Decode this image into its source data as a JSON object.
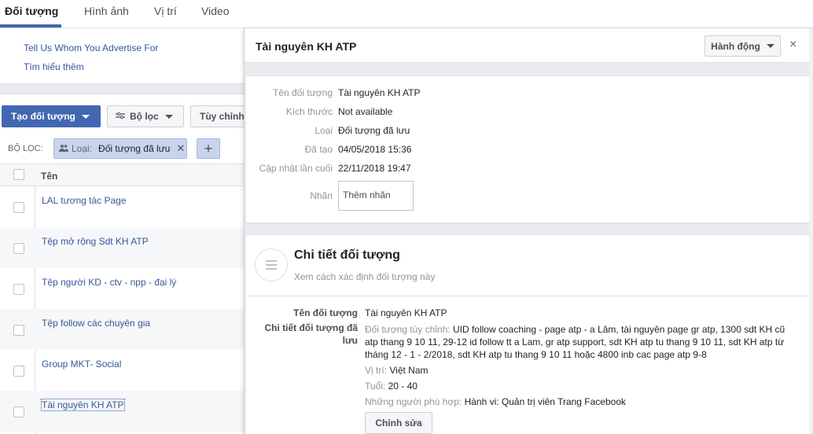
{
  "tabs": [
    {
      "label": "Đối tượng",
      "active": true
    },
    {
      "label": "Hình ảnh",
      "active": false
    },
    {
      "label": "Vị trí",
      "active": false
    },
    {
      "label": "Video",
      "active": false
    }
  ],
  "left": {
    "links": [
      "Tell Us Whom You Advertise For",
      "Tìm hiểu thêm"
    ],
    "create_button": "Tạo đối tượng",
    "filter_button": "Bộ lọc",
    "custom_button": "Tùy chỉnh",
    "filter_label": "BỘ LỌC:",
    "chip": {
      "key": "Loại:",
      "value": "Đối tượng đã lưu"
    },
    "table_header": "Tên",
    "rows": [
      "LAL tương tác Page",
      "Tệp mở rộng Sdt KH ATP",
      "Tệp người KD - ctv - npp - đại lý",
      "Tệp follow các chuyên gia",
      "Group MKT- Social",
      "Tài nguyên KH ATP"
    ]
  },
  "panel": {
    "title": "Tài nguyên KH ATP",
    "action_button": "Hành động",
    "close": "×",
    "details": [
      {
        "label": "Tên đối tượng",
        "value": "Tài nguyên KH ATP"
      },
      {
        "label": "Kích thước",
        "value": "Not available"
      },
      {
        "label": "Loại",
        "value": "Đối tượng đã lưu"
      },
      {
        "label": "Đã tạo",
        "value": "04/05/2018 15:36"
      },
      {
        "label": "Cập nhật lần cuối",
        "value": "22/11/2018 19:47"
      }
    ],
    "tag_label": "Nhãn",
    "tag_placeholder": "Thêm nhãn",
    "section": {
      "title": "Chi tiết đối tượng",
      "subtitle": "Xem cách xác định đối tượng này",
      "name_label": "Tên đối tượng",
      "name_value": "Tài nguyên KH ATP",
      "detail_label": "Chi tiết đối tượng đã lưu",
      "custom_label": "Đối tượng tùy chỉnh:",
      "custom_value": "UID follow coaching - page atp - a Lâm, tài nguyên page gr atp, 1300 sdt KH cũ atp thang 9 10 11, 29-12 id follow tt a Lam, gr atp support, sdt KH atp tu thang 9 10 11, sdt KH atp từ tháng 12 - 1 - 2/2018, sdt KH atp tu thang 9 10 11 hoặc 4800 inb cac page atp 9-8",
      "location_label": "Vị trí:",
      "location_value": "Việt Nam",
      "age_label": "Tuổi:",
      "age_value": "20 - 40",
      "match_label": "Những người phù hợp:",
      "match_value": "Hành vi: Quản trị viên Trang Facebook",
      "edit_button": "Chỉnh sửa"
    }
  },
  "colors": {
    "accent": "#4267b2",
    "link": "#365899"
  }
}
